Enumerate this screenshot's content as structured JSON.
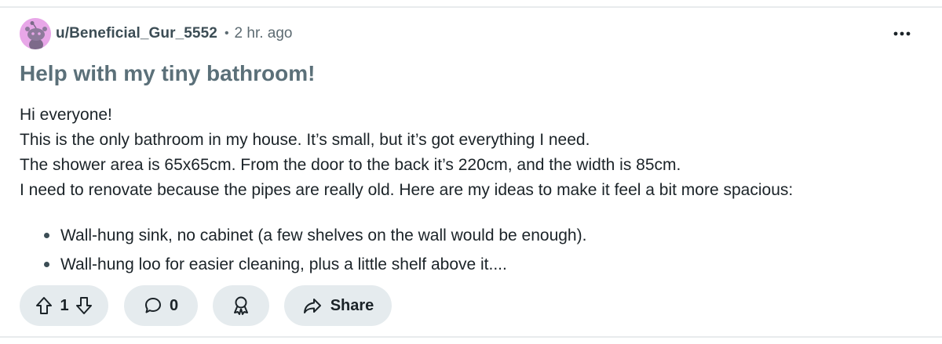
{
  "post": {
    "author": "u/Beneficial_Gur_5552",
    "separator": "•",
    "time": "2 hr. ago",
    "title": "Help with my tiny bathroom!",
    "body": [
      "Hi everyone!",
      "This is the only bathroom in my house. It’s small, but it’s got everything I need.",
      "The shower area is 65x65cm. From the door to the back it’s 220cm, and the width is 85cm.",
      "I need to renovate because the pipes are really old. Here are my ideas to make it feel a bit more spacious:"
    ],
    "bullets": [
      "Wall-hung sink, no cabinet (a few shelves on the wall would be enough).",
      "Wall-hung loo for easier cleaning, plus a little shelf above it...."
    ]
  },
  "actions": {
    "vote_count": "1",
    "comment_count": "0",
    "share_label": "Share",
    "upvote_icon": "upvote-arrow-icon",
    "downvote_icon": "downvote-arrow-icon",
    "comment_icon": "comment-bubble-icon",
    "award_icon": "award-ribbon-icon",
    "share_icon": "share-arrow-icon",
    "more_icon": "more-dots-icon"
  },
  "colors": {
    "avatar_bg": "#e8a7e8",
    "pill_bg": "#e5ebee",
    "title": "#5b7079",
    "text": "#1b2328"
  }
}
